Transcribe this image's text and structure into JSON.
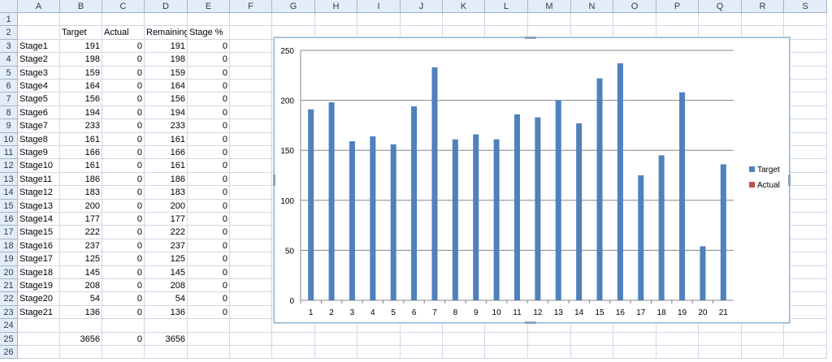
{
  "columns": [
    "A",
    "B",
    "C",
    "D",
    "E",
    "F",
    "G",
    "H",
    "I",
    "J",
    "K",
    "L",
    "M",
    "N",
    "O",
    "P",
    "Q",
    "R",
    "S"
  ],
  "rows": [
    "1",
    "2",
    "3",
    "4",
    "5",
    "6",
    "7",
    "8",
    "9",
    "10",
    "11",
    "12",
    "13",
    "14",
    "15",
    "16",
    "17",
    "18",
    "19",
    "20",
    "21",
    "22",
    "23",
    "24",
    "25",
    "26"
  ],
  "headers": {
    "target": "Target",
    "actual": "Actual",
    "remaining": "Remaining",
    "stage_pct": "Stage %"
  },
  "stages": [
    {
      "name": "Stage1",
      "target": "191",
      "actual": "0",
      "remaining": "191",
      "pct": "0"
    },
    {
      "name": "Stage2",
      "target": "198",
      "actual": "0",
      "remaining": "198",
      "pct": "0"
    },
    {
      "name": "Stage3",
      "target": "159",
      "actual": "0",
      "remaining": "159",
      "pct": "0"
    },
    {
      "name": "Stage4",
      "target": "164",
      "actual": "0",
      "remaining": "164",
      "pct": "0"
    },
    {
      "name": "Stage5",
      "target": "156",
      "actual": "0",
      "remaining": "156",
      "pct": "0"
    },
    {
      "name": "Stage6",
      "target": "194",
      "actual": "0",
      "remaining": "194",
      "pct": "0"
    },
    {
      "name": "Stage7",
      "target": "233",
      "actual": "0",
      "remaining": "233",
      "pct": "0"
    },
    {
      "name": "Stage8",
      "target": "161",
      "actual": "0",
      "remaining": "161",
      "pct": "0"
    },
    {
      "name": "Stage9",
      "target": "166",
      "actual": "0",
      "remaining": "166",
      "pct": "0"
    },
    {
      "name": "Stage10",
      "target": "161",
      "actual": "0",
      "remaining": "161",
      "pct": "0"
    },
    {
      "name": "Stage11",
      "target": "186",
      "actual": "0",
      "remaining": "186",
      "pct": "0"
    },
    {
      "name": "Stage12",
      "target": "183",
      "actual": "0",
      "remaining": "183",
      "pct": "0"
    },
    {
      "name": "Stage13",
      "target": "200",
      "actual": "0",
      "remaining": "200",
      "pct": "0"
    },
    {
      "name": "Stage14",
      "target": "177",
      "actual": "0",
      "remaining": "177",
      "pct": "0"
    },
    {
      "name": "Stage15",
      "target": "222",
      "actual": "0",
      "remaining": "222",
      "pct": "0"
    },
    {
      "name": "Stage16",
      "target": "237",
      "actual": "0",
      "remaining": "237",
      "pct": "0"
    },
    {
      "name": "Stage17",
      "target": "125",
      "actual": "0",
      "remaining": "125",
      "pct": "0"
    },
    {
      "name": "Stage18",
      "target": "145",
      "actual": "0",
      "remaining": "145",
      "pct": "0"
    },
    {
      "name": "Stage19",
      "target": "208",
      "actual": "0",
      "remaining": "208",
      "pct": "0"
    },
    {
      "name": "Stage20",
      "target": "54",
      "actual": "0",
      "remaining": "54",
      "pct": "0"
    },
    {
      "name": "Stage21",
      "target": "136",
      "actual": "0",
      "remaining": "136",
      "pct": "0"
    }
  ],
  "totals": {
    "target": "3656",
    "actual": "0",
    "remaining": "3656"
  },
  "chart_data": {
    "type": "bar",
    "categories": [
      "1",
      "2",
      "3",
      "4",
      "5",
      "6",
      "7",
      "8",
      "9",
      "10",
      "11",
      "12",
      "13",
      "14",
      "15",
      "16",
      "17",
      "18",
      "19",
      "20",
      "21"
    ],
    "series": [
      {
        "name": "Target",
        "values": [
          191,
          198,
          159,
          164,
          156,
          194,
          233,
          161,
          166,
          161,
          186,
          183,
          200,
          177,
          222,
          237,
          125,
          145,
          208,
          54,
          136
        ],
        "color": "#4f81bd"
      },
      {
        "name": "Actual",
        "values": [
          0,
          0,
          0,
          0,
          0,
          0,
          0,
          0,
          0,
          0,
          0,
          0,
          0,
          0,
          0,
          0,
          0,
          0,
          0,
          0,
          0
        ],
        "color": "#c0504d"
      }
    ],
    "yticks": [
      "0",
      "50",
      "100",
      "150",
      "200",
      "250"
    ],
    "ylim": [
      0,
      250
    ],
    "grid": true,
    "legend": "right"
  }
}
